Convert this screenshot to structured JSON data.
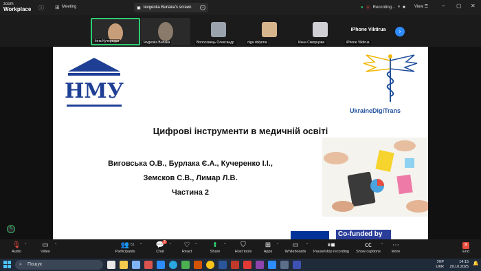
{
  "zoom": {
    "logo_line1": "zoom",
    "logo_line2": "Workplace",
    "meeting_label": "Meeting",
    "share_tab_label": "Ievgeniia Burlaka's screen",
    "recording_label": "Recording...",
    "view_label": "View"
  },
  "participants": [
    {
      "name": "Інна Кучеренко",
      "color": "#c89e7a",
      "active": true
    },
    {
      "name": "Ievgeniia Burlaka",
      "color": "#8a7a6a",
      "active": false
    },
    {
      "name": "Волосовець Олександр",
      "color": "#9aa2ad",
      "active": false
    },
    {
      "name": "olga dolynna",
      "color": "#d7b58c",
      "active": false
    },
    {
      "name": "Инна Скворцова",
      "color": "#cfcfd4",
      "active": false
    },
    {
      "name": "iPhone Viktirua",
      "display": "iPhone Viktirua",
      "active": false
    }
  ],
  "slide": {
    "title": "Цифрові інструменти в медичній освіті",
    "authors_line1": "Виговська О.В., Бурлака Є.А., Кучеренко І.І.,",
    "authors_line2": "Земсков С.В., Лимар Л.В.",
    "part": "Частина 2",
    "partner_logo_text": "UkraineDigiTrans",
    "cofunded_text": "Co-funded by"
  },
  "toolbar": {
    "audio": "Audio",
    "video": "Video",
    "participants": "Participants",
    "participants_count": "51",
    "chat": "Chat",
    "chat_badge": "2",
    "react": "React",
    "share": "Share",
    "host_tools": "Host tools",
    "apps": "Apps",
    "whiteboards": "Whiteboards",
    "pause_stop_recording": "Pause/stop recording",
    "show_captions": "Show captions",
    "more": "More",
    "end": "End"
  },
  "taskbar": {
    "search_placeholder": "Пошук",
    "lang_top": "УКР",
    "lang_bottom": "UKR",
    "time": "14:15",
    "date": "29.10.2025"
  },
  "colors": {
    "accent": "#2d8cff",
    "active_speaker": "#2ecc71",
    "end_button": "#e74c3c",
    "slide_logo_blue": "#1f3f95"
  }
}
